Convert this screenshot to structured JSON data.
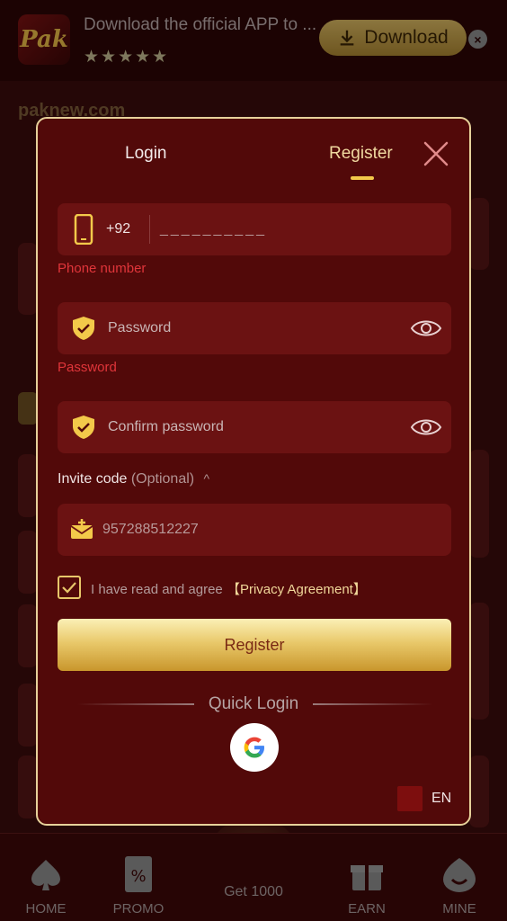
{
  "banner": {
    "logo_text": "Pak",
    "text": "Download the official APP to ...",
    "stars": "★★★★★",
    "download_label": "Download",
    "close_symbol": "×"
  },
  "site": {
    "name": "paknew.com"
  },
  "modal": {
    "tabs": {
      "login": "Login",
      "register": "Register"
    },
    "phone": {
      "country_code": "+92",
      "placeholder": "__________",
      "label": "Phone number"
    },
    "password": {
      "placeholder": "Password",
      "label": "Password"
    },
    "confirm_password": {
      "placeholder": "Confirm password"
    },
    "invite": {
      "label": "Invite code",
      "optional": "(Optional)",
      "value": "957288512227"
    },
    "agreement": {
      "text": "I have read and agree",
      "link": "【Privacy Agreement】",
      "checked": true
    },
    "register_button": "Register",
    "quick_login": "Quick Login",
    "language": "EN"
  },
  "bottom_nav": [
    {
      "label": "HOME",
      "icon": "spade-icon"
    },
    {
      "label": "PROMO",
      "icon": "ticket-icon"
    },
    {
      "label": "Get 1000",
      "icon": "wheel-icon"
    },
    {
      "label": "EARN",
      "icon": "gift-icon"
    },
    {
      "label": "MINE",
      "icon": "user-icon"
    }
  ],
  "colors": {
    "accent_gold": "#f3c94a",
    "modal_bg": "#520909",
    "field_bg": "#6b1212",
    "error_red": "#e0353a"
  }
}
